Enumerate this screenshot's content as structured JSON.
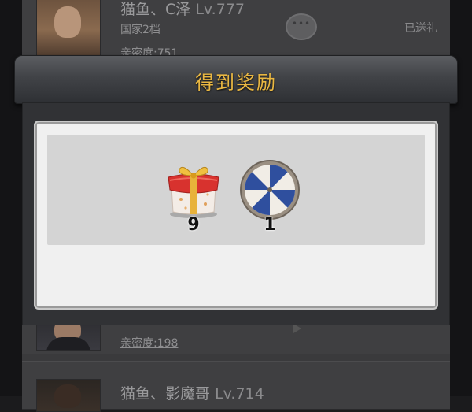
{
  "background_list": {
    "players": [
      {
        "name": "猫鱼、C泽",
        "level": "Lv.777",
        "rank": "国家2档",
        "intimacy": "亲密度:751",
        "gift_status": "已送礼"
      },
      {
        "intimacy": "亲密度:198"
      },
      {
        "name": "猫鱼、影魔哥",
        "level": "Lv.714"
      }
    ]
  },
  "dialog": {
    "title": "得到奖励",
    "rewards": [
      {
        "icon": "gift-box-icon",
        "count": "9"
      },
      {
        "icon": "prize-wheel-icon",
        "count": "1"
      }
    ]
  },
  "colors": {
    "title_gold": "#e9b742",
    "header_dark": "#2e3034",
    "panel_light": "#f0f0f0",
    "gift_red": "#d8322e",
    "wheel_blue": "#2f4f9e"
  }
}
